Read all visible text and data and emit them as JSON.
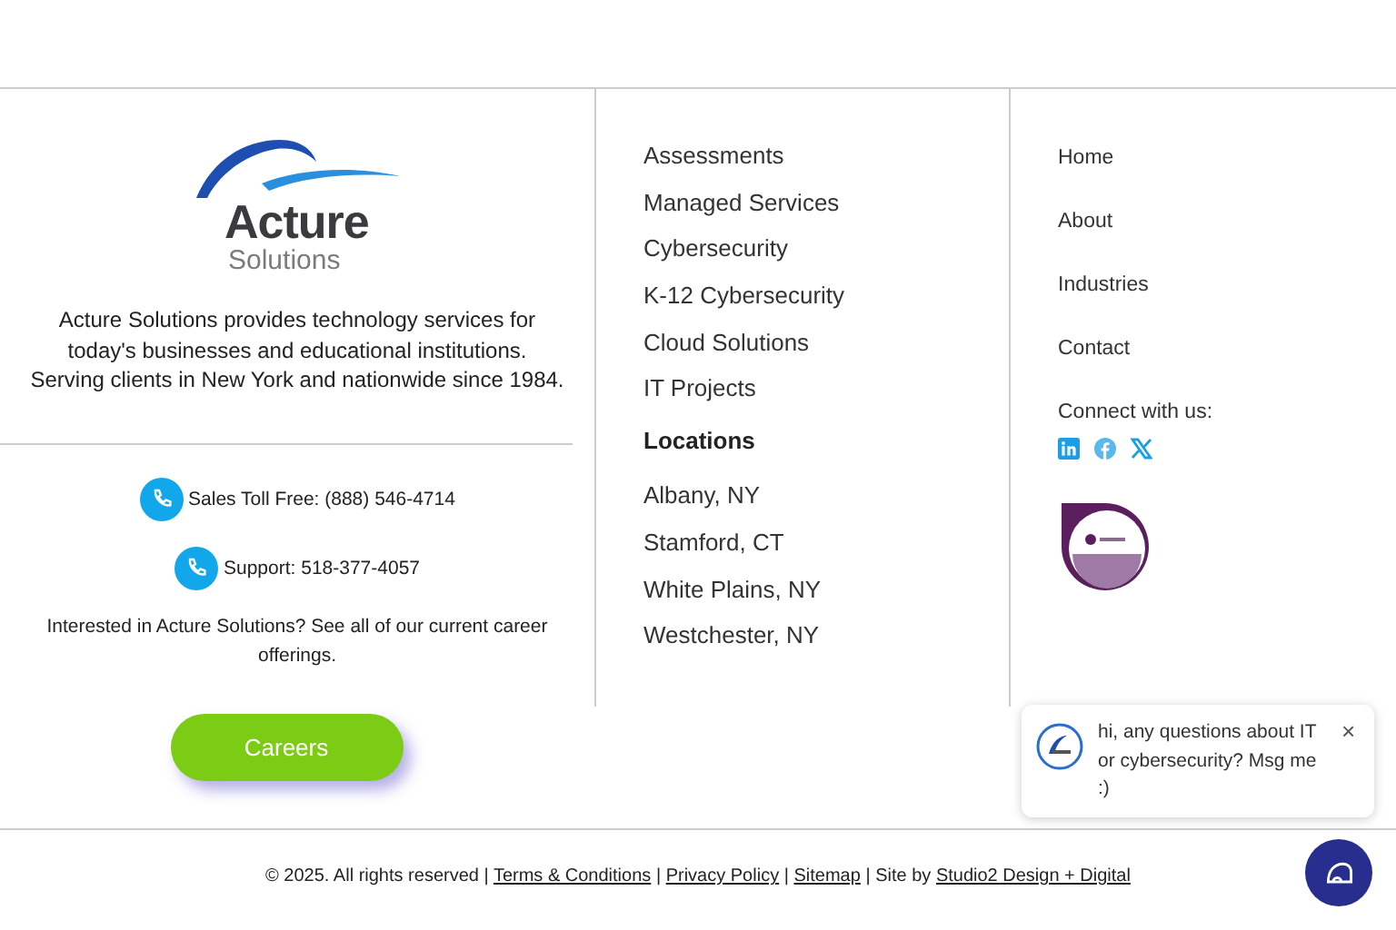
{
  "about": {
    "logo": {
      "name": "Acture",
      "tagline": "Solutions"
    },
    "description": [
      "Acture Solutions provides technology services for",
      "today's businesses and educational institutions.",
      "Serving clients in New York and nationwide since 1984."
    ],
    "phones": [
      {
        "label": "Sales Toll Free: (888) 546-4714"
      },
      {
        "label": "Support: 518-377-4057"
      }
    ],
    "careers_text": "Interested in Acture Solutions? See all of our current career offerings.",
    "careers_button": "Careers"
  },
  "services": [
    "Assessments",
    "Managed Services",
    "Cybersecurity",
    "K-12 Cybersecurity",
    "Cloud Solutions",
    "IT Projects"
  ],
  "locations": {
    "heading": "Locations",
    "items": [
      "Albany, NY",
      "Stamford, CT",
      "White Plains, NY",
      "Westchester, NY"
    ]
  },
  "nav": [
    "Home",
    "About",
    "Industries",
    "Contact"
  ],
  "connect": {
    "label": "Connect with us:",
    "social": [
      {
        "kind": "linkedin"
      },
      {
        "kind": "facebook"
      },
      {
        "kind": "x"
      }
    ]
  },
  "footer": [
    {
      "kind": "text",
      "text": "© 2025. All rights reserved |"
    },
    {
      "kind": "link",
      "text": "Terms & Conditions"
    },
    {
      "kind": "text",
      "text": "|"
    },
    {
      "kind": "link",
      "text": "Privacy Policy"
    },
    {
      "kind": "text",
      "text": "|"
    },
    {
      "kind": "link",
      "text": "Sitemap"
    },
    {
      "kind": "text",
      "text": "| Site by"
    },
    {
      "kind": "link",
      "text": "Studio2 Design + Digital"
    }
  ],
  "chat": {
    "message": "hi, any questions about IT or cybersecurity? Msg me :)",
    "close": "×"
  }
}
